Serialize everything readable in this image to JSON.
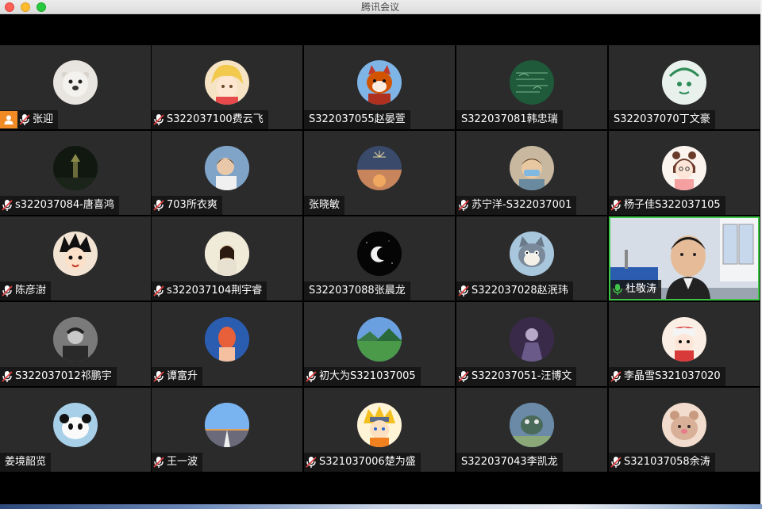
{
  "window": {
    "title": "腾讯会议"
  },
  "participants": [
    {
      "name": "张迎",
      "mic": "muted",
      "host": true,
      "avatar": "dog-photo",
      "bg": "#e8e4df"
    },
    {
      "name": "S322037100费云飞",
      "mic": "muted",
      "avatar": "anime-boy",
      "bg": "#f6e3c4"
    },
    {
      "name": "S322037055赵晏萱",
      "mic": "none",
      "avatar": "fox-plush",
      "bg": "#7fb4e6"
    },
    {
      "name": "S322037081韩忠瑞",
      "mic": "none",
      "avatar": "chalkboard",
      "bg": "#1f5a3a"
    },
    {
      "name": "S322037070丁文豪",
      "mic": "none",
      "avatar": "green-sketch",
      "bg": "#e8f1ec"
    },
    {
      "name": "s322037084-唐喜鸿",
      "mic": "muted",
      "avatar": "night-tower",
      "bg": "#101810"
    },
    {
      "name": "703所衣爽",
      "mic": "muted",
      "avatar": "girl-photo",
      "bg": "#6a8ab0"
    },
    {
      "name": "张晓敏",
      "mic": "none",
      "avatar": "fireworks",
      "bg": "#3a4a6a"
    },
    {
      "name": "苏宁洋-S322037001",
      "mic": "muted",
      "avatar": "man-mask",
      "bg": "#c8b8a0"
    },
    {
      "name": "杨子佳S322037105",
      "mic": "muted",
      "avatar": "cartoon-girl",
      "bg": "#fbf3ee"
    },
    {
      "name": "陈彦澍",
      "mic": "muted",
      "avatar": "goku",
      "bg": "#f2e3d2"
    },
    {
      "name": "s322037104荆宇睿",
      "mic": "muted",
      "avatar": "student-photo",
      "bg": "#e9e2cf"
    },
    {
      "name": "S322037088张晨龙",
      "mic": "none",
      "avatar": "moon",
      "bg": "#050505"
    },
    {
      "name": "S322037028赵泯玮",
      "mic": "muted",
      "avatar": "tom-cat",
      "bg": "#a9c7dc"
    },
    {
      "name": "杜敬涛",
      "mic": "active",
      "avatar": "video",
      "bg": "#c8d0dc",
      "video": true
    },
    {
      "name": "S322037012祁鹏宇",
      "mic": "muted",
      "avatar": "bw-photo",
      "bg": "#6a6a6a"
    },
    {
      "name": "谭富升",
      "mic": "muted",
      "avatar": "art-head",
      "bg": "#2a5cb0"
    },
    {
      "name": "初大为S321037005",
      "mic": "muted",
      "avatar": "landscape",
      "bg": "#5a8ac8"
    },
    {
      "name": "S322037051-汪博文",
      "mic": "muted",
      "avatar": "dark-figure",
      "bg": "#4a3a5a"
    },
    {
      "name": "李晶雪S321037020",
      "mic": "muted",
      "avatar": "chibi-red",
      "bg": "#fbeee4"
    },
    {
      "name": "姜境韶览",
      "mic": "none",
      "avatar": "panda",
      "bg": "#a7d0e8"
    },
    {
      "name": "王一波",
      "mic": "muted",
      "avatar": "road",
      "bg": "#6aa2e0"
    },
    {
      "name": "S321037006楚为盛",
      "mic": "muted",
      "avatar": "naruto",
      "bg": "#fff4d6"
    },
    {
      "name": "S322037043李凯龙",
      "mic": "none",
      "avatar": "animal-photo",
      "bg": "#7a9ab8"
    },
    {
      "name": "S321037058余涛",
      "mic": "muted",
      "avatar": "bear",
      "bg": "#f2dccd"
    }
  ],
  "colors": {
    "active_border": "#3ec447",
    "host_badge": "#f08a24",
    "tile_bg": "#2b2b2c",
    "muted_mic": "#e04040"
  }
}
